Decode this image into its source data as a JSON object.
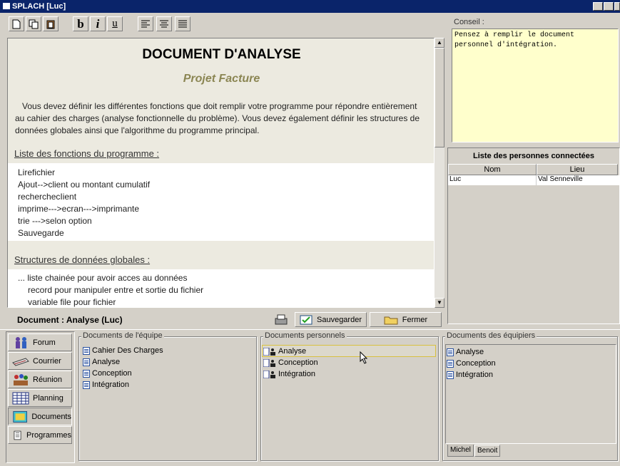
{
  "window": {
    "title": "SPLACH [Luc]"
  },
  "toolbar": {
    "bold": "b",
    "italic": "i",
    "underline": "u"
  },
  "document": {
    "title": "DOCUMENT D'ANALYSE",
    "subtitle": "Projet Facture",
    "intro": "Vous devez définir les différentes fonctions que doit remplir votre programme pour répondre entièrement au cahier des charges (analyse fonctionnelle du problème). Vous devez également définir les structures de données globales ainsi que l'algorithme du programme principal.",
    "section1": "Liste des fonctions du programme :",
    "functions": [
      "Lirefichier",
      "Ajout-->client ou montant cumulatif",
      "recherchecIient",
      "imprime--->ecran--->imprimante",
      "trie --->selon option",
      "Sauvegarde"
    ],
    "section2": "Structures de données globales :",
    "structures": [
      "... liste chainée pour avoir acces au données",
      "record pour manipuler entre et sortie du fichier",
      "variable file pour fichier"
    ],
    "status": "Document : Analyse (Luc)",
    "save": "Sauvegarder",
    "close": "Fermer"
  },
  "conseil": {
    "label": "Conseil :",
    "text": "Pensez à remplir le document personnel d'intégration."
  },
  "persons": {
    "title": "Liste des personnes connectées",
    "col_nom": "Nom",
    "col_lieu": "Lieu",
    "rows": [
      {
        "nom": "Luc",
        "lieu": "Val Senneville"
      }
    ]
  },
  "nav": [
    "Forum",
    "Courrier",
    "Réunion",
    "Planning",
    "Documents",
    "Programmes"
  ],
  "team_docs": {
    "label": "Documents de l'équipe",
    "items": [
      "Cahier Des Charges",
      "Analyse",
      "Conception",
      "Intégration"
    ]
  },
  "personal_docs": {
    "label": "Documents personnels",
    "items": [
      "Analyse",
      "Conception",
      "Intégration"
    ]
  },
  "teammates_docs": {
    "label": "Documents des équipiers",
    "items": [
      "Analyse",
      "Conception",
      "Intégration"
    ],
    "tabs": [
      "Michel",
      "Benoit"
    ]
  }
}
